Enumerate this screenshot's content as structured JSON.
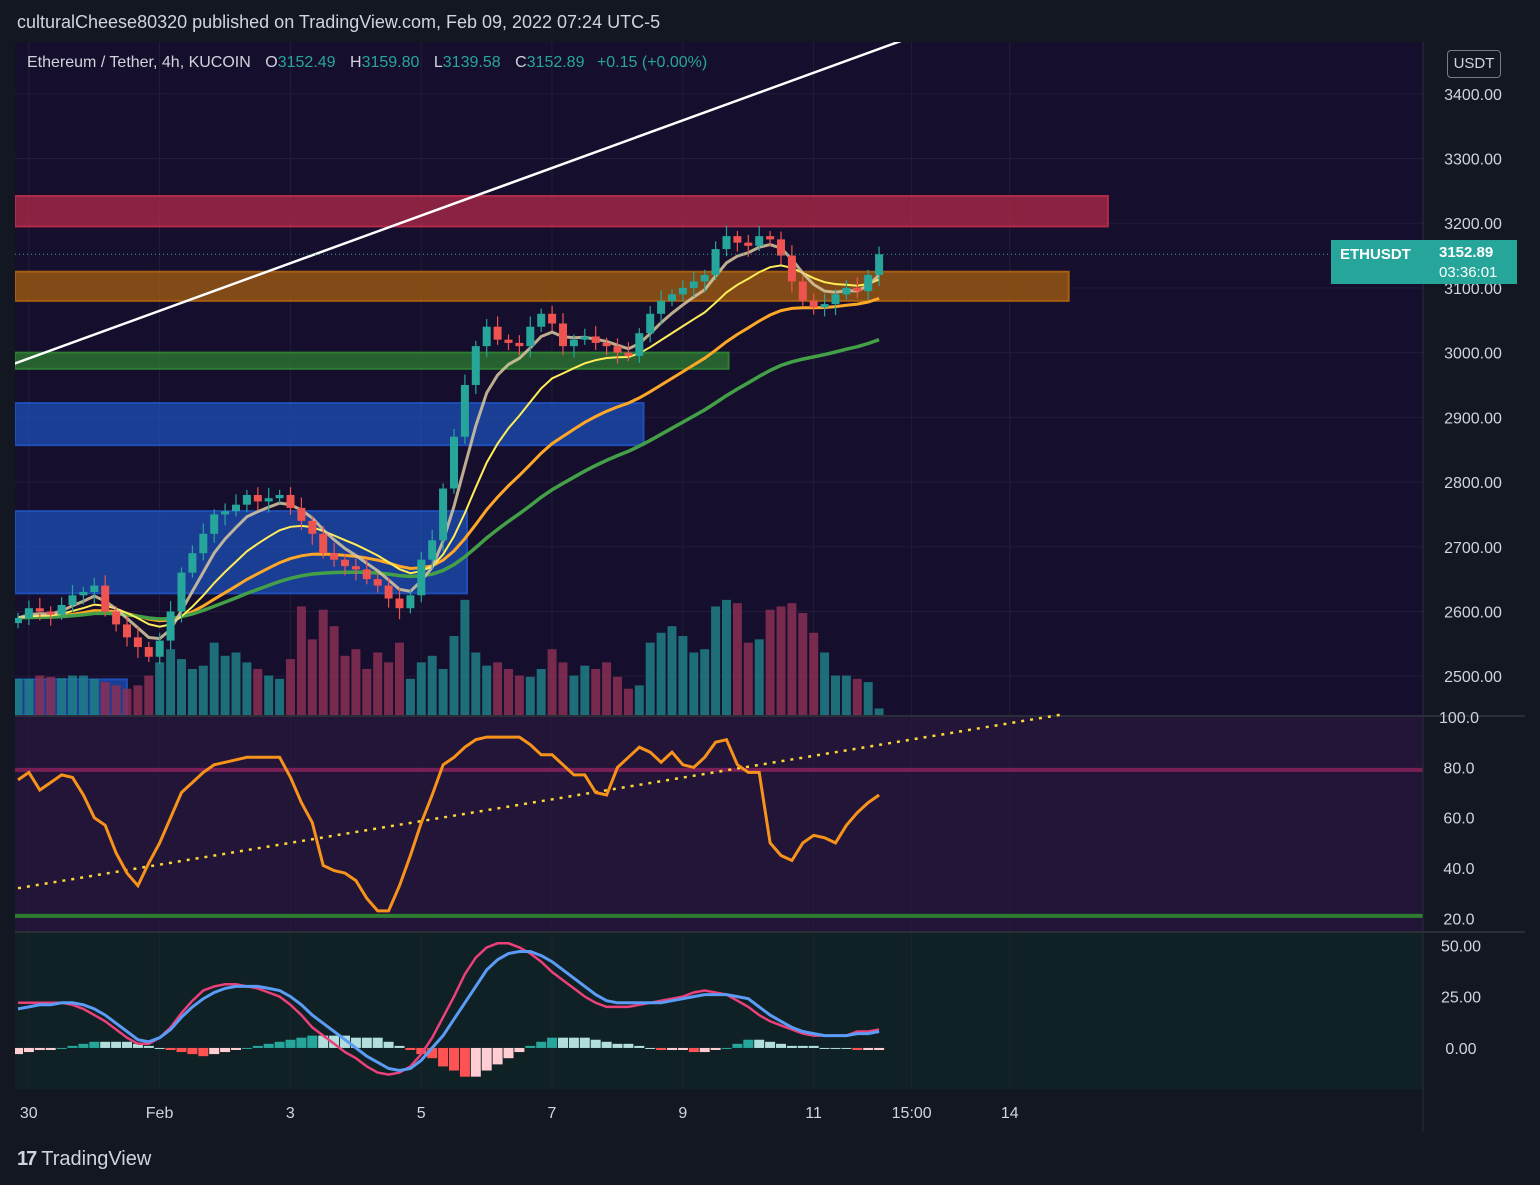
{
  "header": {
    "published_by": "culturalCheese80320 published on TradingView.com, Feb 09, 2022 07:24 UTC-5"
  },
  "legend": {
    "symbol": "Ethereum / Tether, 4h, KUCOIN",
    "o_label": "O",
    "o_value": "3152.49",
    "h_label": "H",
    "h_value": "3159.80",
    "l_label": "L",
    "l_value": "3139.58",
    "c_label": "C",
    "c_value": "3152.89",
    "change": "+0.15 (+0.00%)"
  },
  "currency_button": "USDT",
  "last_price": {
    "symbol": "ETHUSDT",
    "price": "3152.89",
    "countdown": "03:36:01"
  },
  "footer": {
    "brand": "TradingView"
  },
  "colors": {
    "up": "#26a69a",
    "down": "#ef5350",
    "rsi": "#f7931a",
    "macd": "#5b9cf6",
    "signal": "#ec407a",
    "zone_red": "#b22a4a",
    "zone_orange": "#a65f10",
    "zone_green": "#2e7d32",
    "zone_blue": "#1e4fb8"
  },
  "chart_data": [
    {
      "type": "candlestick",
      "name": "price",
      "ylim": [
        2440,
        3480
      ],
      "y_ticks": [
        "3400.00",
        "3300.00",
        "3200.00",
        "3100.00",
        "3000.00",
        "2900.00",
        "2800.00",
        "2700.00",
        "2600.00",
        "2500.00"
      ],
      "y_tick_values": [
        3400,
        3300,
        3200,
        3100,
        3000,
        2900,
        2800,
        2700,
        2600,
        2500
      ],
      "x_ticks": [
        "30",
        "Feb",
        "3",
        "5",
        "7",
        "9",
        "11",
        "15:00",
        "14"
      ],
      "x_tick_days": [
        0,
        2,
        4,
        6,
        8,
        10,
        12,
        13.5,
        15
      ],
      "closes": [
        2590,
        2605,
        2600,
        2595,
        2610,
        2625,
        2630,
        2640,
        2600,
        2580,
        2560,
        2545,
        2530,
        2555,
        2600,
        2660,
        2690,
        2720,
        2750,
        2755,
        2765,
        2780,
        2770,
        2775,
        2780,
        2760,
        2740,
        2720,
        2690,
        2680,
        2670,
        2665,
        2650,
        2640,
        2620,
        2605,
        2625,
        2680,
        2710,
        2790,
        2870,
        2950,
        3010,
        3040,
        3020,
        3015,
        3010,
        3040,
        3060,
        3045,
        3010,
        3020,
        3025,
        3015,
        3010,
        3000,
        2995,
        3030,
        3060,
        3080,
        3090,
        3100,
        3110,
        3120,
        3160,
        3180,
        3170,
        3165,
        3180,
        3175,
        3150,
        3110,
        3080,
        3070,
        3075,
        3090,
        3100,
        3095,
        3120,
        3152
      ],
      "volumes": [
        55,
        55,
        60,
        58,
        56,
        60,
        60,
        55,
        50,
        45,
        40,
        45,
        60,
        80,
        100,
        85,
        70,
        75,
        110,
        90,
        95,
        80,
        70,
        60,
        55,
        85,
        165,
        115,
        160,
        135,
        90,
        100,
        70,
        95,
        80,
        110,
        55,
        80,
        90,
        70,
        120,
        175,
        95,
        75,
        80,
        70,
        60,
        58,
        70,
        100,
        80,
        60,
        75,
        70,
        80,
        58,
        40,
        45,
        110,
        125,
        135,
        120,
        95,
        100,
        165,
        175,
        170,
        110,
        115,
        160,
        165,
        170,
        155,
        125,
        95,
        60,
        60,
        55,
        50,
        10
      ],
      "zones": [
        {
          "name": "resistance-red",
          "lo": 3195,
          "hi": 3242,
          "x_from_day": -0.3,
          "x_to_day": 16.5
        },
        {
          "name": "resistance-orange",
          "lo": 3080,
          "hi": 3125,
          "x_from_day": -0.3,
          "x_to_day": 15.9
        },
        {
          "name": "support-green",
          "lo": 2975,
          "hi": 3000,
          "x_from_day": -0.3,
          "x_to_day": 10.7
        },
        {
          "name": "support-blue-upper",
          "lo": 2857,
          "hi": 2922,
          "x_from_day": -0.3,
          "x_to_day": 9.4
        },
        {
          "name": "support-blue-lower",
          "lo": 2628,
          "hi": 2755,
          "x_from_day": -0.3,
          "x_to_day": 6.7
        },
        {
          "name": "support-blue-bottom",
          "lo": 2440,
          "hi": 2495,
          "x_from_day": -0.3,
          "x_to_day": 1.5
        }
      ],
      "trendline": {
        "from": [
          -0.3,
          2980
        ],
        "to": [
          13.7,
          3495
        ]
      }
    },
    {
      "type": "line",
      "name": "rsi",
      "ylim": [
        15,
        100
      ],
      "y_ticks": [
        "100.0",
        "80.0",
        "60.0",
        "40.0",
        "20.0"
      ],
      "y_tick_values": [
        100,
        80,
        60,
        40,
        20
      ],
      "levels": [
        79,
        21
      ],
      "values": [
        75,
        78,
        71,
        74,
        77,
        76,
        69,
        60,
        57,
        46,
        38,
        33,
        42,
        50,
        60,
        70,
        74,
        78,
        81,
        82,
        83,
        84,
        84,
        84,
        84,
        76,
        66,
        58,
        41,
        39,
        38,
        35,
        28,
        23,
        23,
        33,
        45,
        58,
        69,
        81,
        84,
        88,
        91,
        92,
        92,
        92,
        92,
        89,
        85,
        85,
        81,
        77,
        77,
        70,
        69,
        80,
        84,
        88,
        86,
        82,
        86,
        81,
        80,
        84,
        90,
        91,
        81,
        78,
        78,
        50,
        45,
        43,
        50,
        53,
        52,
        50,
        57,
        62,
        66,
        69
      ],
      "dotted_trend": {
        "from": [
          0,
          32
        ],
        "to": [
          15.8,
          101
        ]
      }
    },
    {
      "type": "line",
      "name": "macd",
      "ylim": [
        -20,
        56
      ],
      "y_ticks": [
        "50.00",
        "25.00",
        "0.00"
      ],
      "y_tick_values": [
        50,
        25,
        0
      ],
      "macd": [
        19,
        20,
        21,
        21,
        22,
        22,
        21,
        19,
        16,
        12,
        8,
        4,
        3,
        5,
        9,
        15,
        20,
        24,
        27,
        29,
        30,
        30,
        30,
        29,
        28,
        25,
        21,
        16,
        12,
        8,
        4,
        0,
        -4,
        -7,
        -10,
        -11,
        -10,
        -6,
        0,
        6,
        14,
        22,
        30,
        38,
        43,
        46,
        47,
        47,
        45,
        42,
        38,
        34,
        30,
        26,
        23,
        22,
        22,
        22,
        22,
        22,
        23,
        24,
        25,
        26,
        26,
        26,
        25,
        24,
        20,
        16,
        13,
        10,
        8,
        7,
        6,
        6,
        6,
        7,
        7,
        8
      ],
      "signal": [
        22,
        22,
        22,
        22,
        22,
        21,
        19,
        16,
        13,
        9,
        5,
        2,
        2,
        5,
        10,
        17,
        23,
        28,
        30,
        31,
        31,
        30,
        29,
        27,
        25,
        21,
        16,
        10,
        6,
        2,
        -2,
        -5,
        -9,
        -12,
        -13,
        -12,
        -9,
        -3,
        5,
        15,
        25,
        36,
        44,
        49,
        51,
        51,
        49,
        46,
        42,
        37,
        33,
        29,
        25,
        22,
        20,
        20,
        20,
        21,
        22,
        23,
        24,
        25,
        27,
        28,
        27,
        26,
        23,
        20,
        16,
        13,
        11,
        9,
        7,
        6,
        6,
        6,
        6,
        8,
        8,
        9
      ]
    }
  ]
}
